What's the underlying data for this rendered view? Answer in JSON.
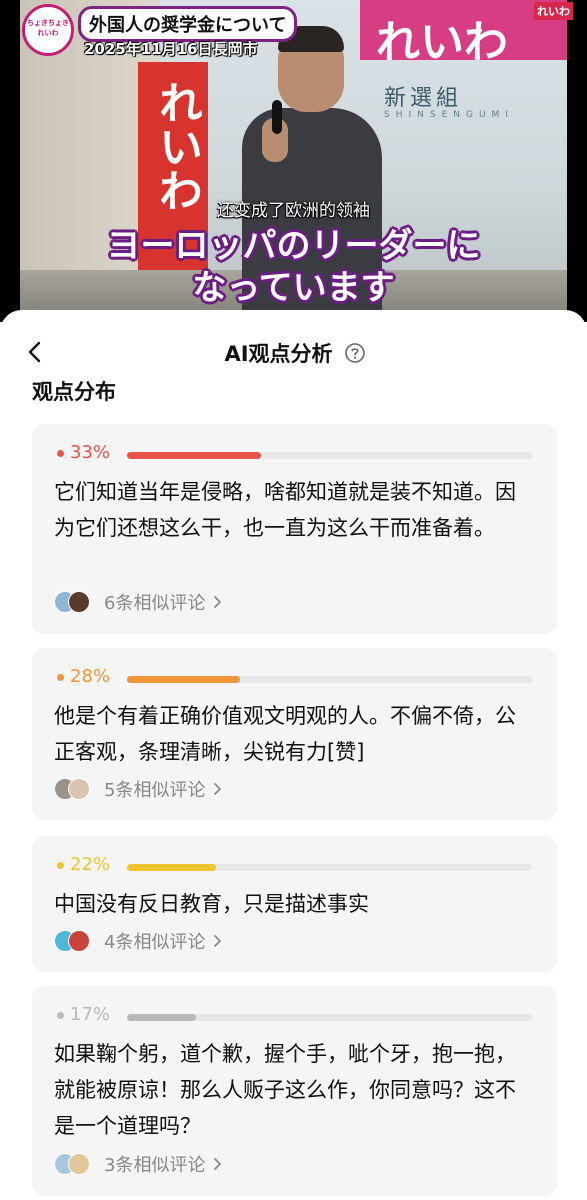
{
  "video": {
    "logo_badge_text": "ちょきちょきれいわ",
    "title_caption": "外国人の奨学金について",
    "date_caption": "2025年11月16日長岡市",
    "corner_logo": "れいわ",
    "banner_left_text": "れいわ",
    "banner_right_text": "れいわ",
    "banner_right_sub": "新選組",
    "banner_right_sub2": "SHINSENGUMI",
    "subtitle_cn": "还变成了欧洲的领袖",
    "subtitle_jp_line1": "ヨーロッパのリーダーに",
    "subtitle_jp_line2": "なっています"
  },
  "sheet": {
    "title": "AI观点分析",
    "section_title": "观点分布",
    "help_icon": "question-circle-icon",
    "back_icon": "chevron-left-icon",
    "cards": [
      {
        "percent_label": "33%",
        "percent": 33,
        "color": "#e8534a",
        "text": "它们知道当年是侵略，啥都知道就是装不知道。因为它们还想这么干，也一直为这么干而准备着。",
        "similar": "6条相似评论"
      },
      {
        "percent_label": "28%",
        "percent": 28,
        "color": "#f0953a",
        "text": "他是个有着正确价值观文明观的人。不偏不倚，公正客观，条理清晰，尖锐有力[赞]",
        "similar": "5条相似评论"
      },
      {
        "percent_label": "22%",
        "percent": 22,
        "color": "#efc52f",
        "text": "中国没有反日教育，只是描述事实",
        "similar": "4条相似评论"
      },
      {
        "percent_label": "17%",
        "percent": 17,
        "color": "#b9b9b9",
        "text": "如果鞠个躬，道个歉，握个手，呲个牙，抱一抱，就能被原谅！那么人贩子这么作，你同意吗？这不是一个道理吗？",
        "similar": "3条相似评论"
      }
    ]
  }
}
